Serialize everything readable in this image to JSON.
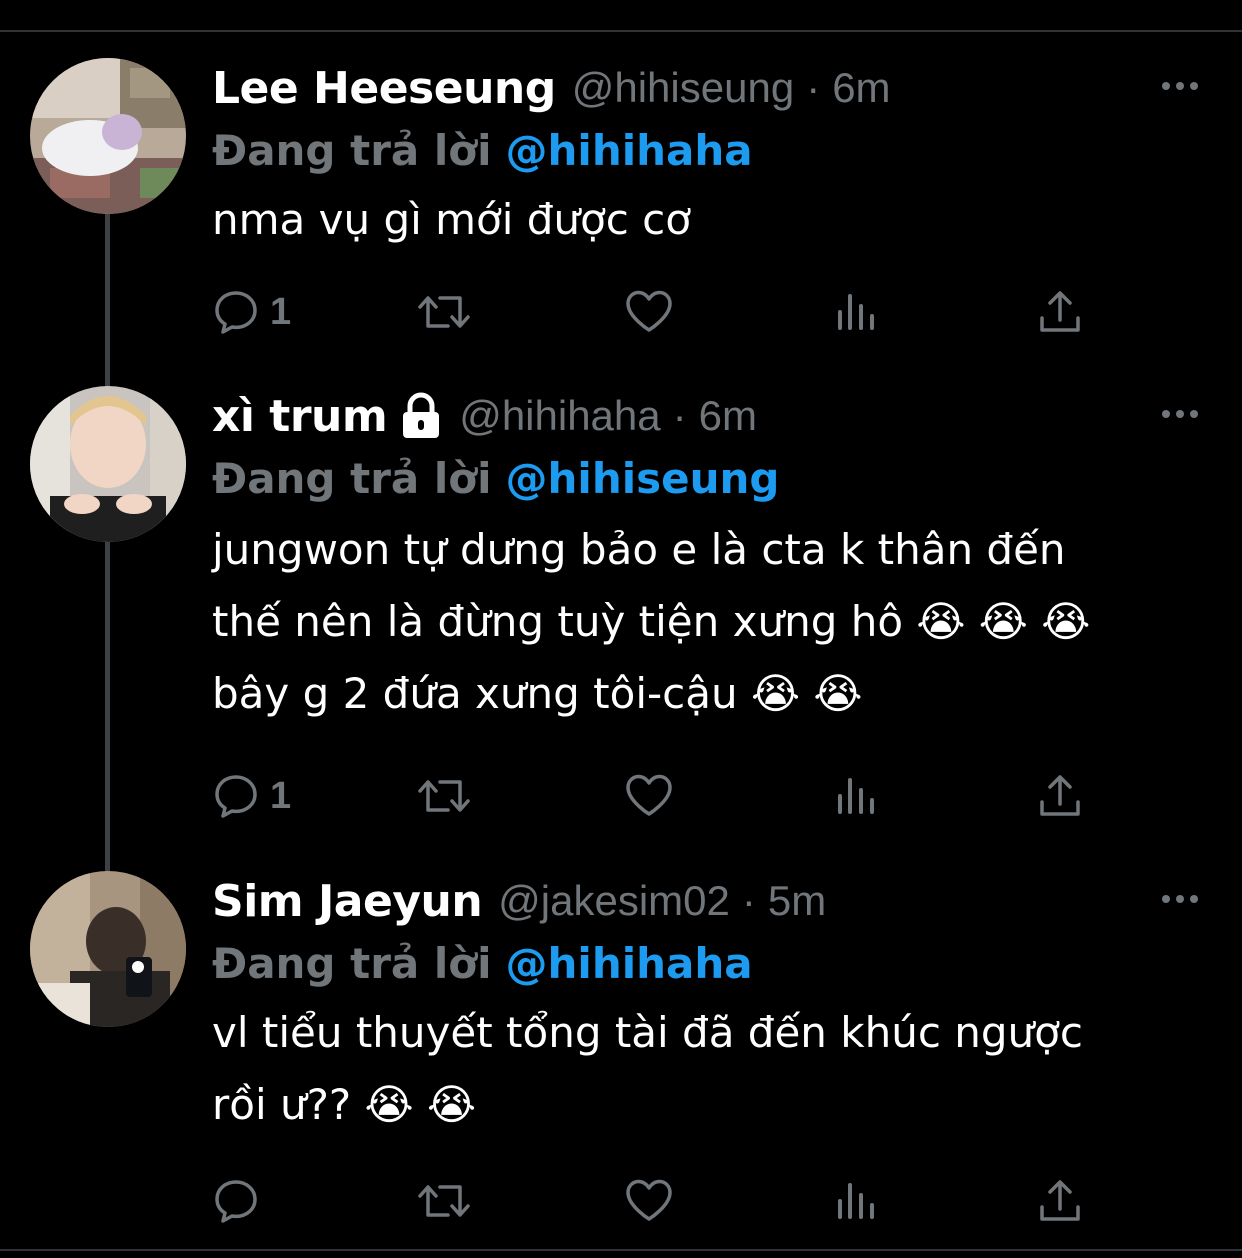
{
  "tweets": [
    {
      "name": "Lee Heeseung",
      "handle": "@hihiseung",
      "separator": "·",
      "time": "6m",
      "replying_prefix": "Đang trả lời",
      "replying_to": "@hihihaha",
      "text": "nma vụ gì mới được cơ",
      "reply_count": "1",
      "locked": false
    },
    {
      "name": "xì trum",
      "handle": "@hihihaha",
      "separator": "·",
      "time": "6m",
      "replying_prefix": "Đang trả lời",
      "replying_to": "@hihiseung",
      "text": "jungwon tự dưng bảo e là cta k thân đến\nthế nên là đừng tuỳ tiện xưng hô 😭 😭 😭\nbây g 2 đứa xưng tôi-cậu 😭 😭",
      "reply_count": "1",
      "locked": true
    },
    {
      "name": "Sim Jaeyun",
      "handle": "@jakesim02",
      "separator": "·",
      "time": "5m",
      "replying_prefix": "Đang trả lời",
      "replying_to": "@hihihaha",
      "text": "vl tiểu thuyết tổng tài đã đến khúc ngược\nrồi ư?? 😭 😭",
      "reply_count": "",
      "locked": false
    }
  ],
  "icons": {
    "reply": "reply-icon",
    "retweet": "retweet-icon",
    "like": "heart-icon",
    "analytics": "analytics-icon",
    "share": "share-icon",
    "more": "more-icon",
    "lock": "lock-icon"
  },
  "colors": {
    "background": "#000000",
    "name": "#ffffff",
    "muted": "#71767b",
    "accent": "#1d9bf0",
    "thread_line": "#3d4145"
  }
}
